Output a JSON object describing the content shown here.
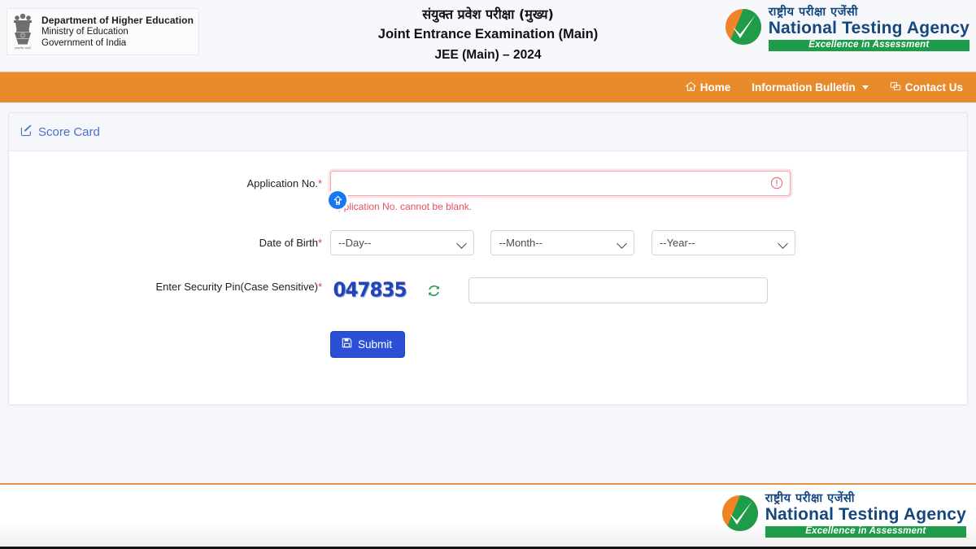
{
  "header": {
    "emblem_icon": "india-state-emblem-icon",
    "department_line1": "Department of Higher Education",
    "department_line2": "Ministry of Education",
    "department_line3": "Government of India",
    "title_hindi": "संयुक्त प्रवेश परीक्षा (मुख्य)",
    "title_english": "Joint Entrance Examination (Main)",
    "title_exam": "JEE (Main) – 2024",
    "nta_hindi": "राष्ट्रीय  परीक्षा  एजेंसी",
    "nta_english": "National Testing Agency",
    "nta_tagline": "Excellence in Assessment",
    "brand_blue": "#15477e",
    "brand_green": "#1f9c4a",
    "brand_orange": "#ef8326"
  },
  "navbar": {
    "background": "#e78b2c",
    "items": [
      {
        "label": "Home",
        "icon": "home-icon",
        "has_caret": false
      },
      {
        "label": "Information Bulletin",
        "icon": "",
        "has_caret": true
      },
      {
        "label": "Contact Us",
        "icon": "chat-icon",
        "has_caret": false
      }
    ]
  },
  "card": {
    "title": "Score Card",
    "title_icon": "edit-square-icon",
    "title_color": "#4a72c4"
  },
  "form": {
    "application": {
      "label": "Application No.",
      "required_mark": "*",
      "value": "",
      "placeholder": "",
      "error": "Application No. cannot be blank.",
      "error_color": "#e8505b",
      "warning_icon": "exclamation-circle-icon"
    },
    "dob": {
      "label": "Date of Birth",
      "required_mark": "*",
      "day": {
        "selected": "--Day--",
        "options": [
          "--Day--"
        ]
      },
      "month": {
        "selected": "--Month--",
        "options": [
          "--Month--"
        ]
      },
      "year": {
        "selected": "--Year--",
        "options": [
          "--Year--"
        ]
      }
    },
    "security_pin": {
      "label": "Enter Security Pin(Case Sensitive)",
      "required_mark": "*",
      "captcha_value": "047835",
      "captcha_color": "#2244b8",
      "refresh_icon": "refresh-icon",
      "input_value": "",
      "placeholder": ""
    },
    "submit": {
      "label": "Submit",
      "icon": "save-icon",
      "color": "#2b4fd6"
    }
  },
  "cursor": {
    "icon": "cursor-shift-badge-icon",
    "color": "#1877f2"
  },
  "footer": {
    "nta_hindi": "राष्ट्रीय  परीक्षा  एजेंसी",
    "nta_english": "National Testing Agency",
    "nta_tagline": "Excellence in Assessment",
    "top_border_color": "#e2944a"
  }
}
